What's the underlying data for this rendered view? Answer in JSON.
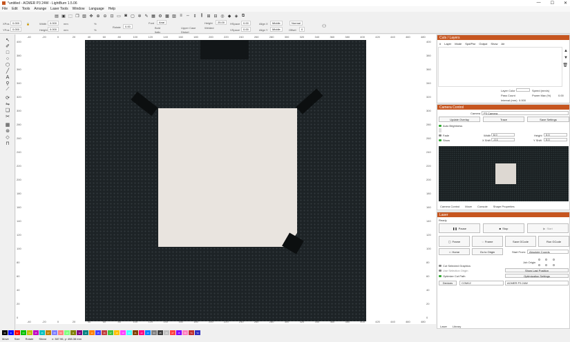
{
  "window": {
    "title": "*untitled - ACMER P3 24W - LightBurn 1.5.06",
    "min": "—",
    "max": "☐",
    "close": "✕"
  },
  "menu": [
    "File",
    "Edit",
    "Tools",
    "Arrange",
    "Laser Tools",
    "Window",
    "Language",
    "Help"
  ],
  "toolbar2": {
    "xpos_label": "XPos",
    "xpos": "0.000",
    "ypos_label": "YPos",
    "ypos": "0.000",
    "width_label": "Width",
    "width": "0.000",
    "height_label": "Height",
    "height": "0.000",
    "unit1": "mm",
    "unit2": "mm",
    "pct1": "%",
    "pct2": "%",
    "rotate_label": "Rotate",
    "rotate": "0.00",
    "font_label": "Font",
    "font": "Arial",
    "bold": "Bold",
    "italic": "Italic",
    "upper_case": "Upper Case",
    "welded": "Welded",
    "distort": "Distort",
    "height_text_label": "Height",
    "height_text": "25.00",
    "hspace_label": "HSpace",
    "hspace": "0.00",
    "vspace_label": "VSpace",
    "vspace": "0.00",
    "align_x_label": "Align X",
    "align_x": "Middle",
    "align_y_label": "Align Y",
    "align_y": "Middle",
    "normal": "Normal",
    "offset_label": "Offset",
    "offset": "0"
  },
  "rulers": {
    "top": [
      "-40",
      "-20",
      "0",
      "20",
      "40",
      "60",
      "80",
      "100",
      "120",
      "140",
      "160",
      "180",
      "200",
      "220",
      "240",
      "260",
      "280",
      "300",
      "320",
      "340",
      "360",
      "380",
      "400",
      "420",
      "440",
      "460",
      "480"
    ],
    "left": [
      "400",
      "380",
      "360",
      "340",
      "320",
      "300",
      "280",
      "260",
      "240",
      "220",
      "200",
      "180",
      "160",
      "140",
      "120",
      "100",
      "80",
      "60",
      "40",
      "20",
      "0"
    ]
  },
  "cuts_layers": {
    "title": "Cuts / Layers",
    "columns": [
      "#",
      "Layer",
      "Mode",
      "Spd/Pwr",
      "Output",
      "Show",
      "Air"
    ],
    "layer_color": "Layer Color",
    "speed_label": "Speed (mm/s)",
    "pass_count": "Pass Count",
    "power_label": "Power Max (%)",
    "interval_label": "Interval (mm)",
    "interval": "0.000",
    "power_value": "0.00"
  },
  "camera": {
    "title": "Camera Control",
    "camera_label": "Camera",
    "camera_value": "P3 Camera",
    "update_overlay": "Update Overlay",
    "trace": "Trace",
    "save_settings": "Save Settings",
    "auto_brightness": "Auto Brightness",
    "fade": "Fade",
    "show": "Show",
    "width_label": "Width",
    "width": "6.0",
    "height_label": "Height",
    "height": "0.0",
    "xshift_label": "X Shift",
    "xshift": "-0.1",
    "yshift_label": "Y Shift",
    "yshift": "0.0",
    "tabs": [
      "Camera Control",
      "Move",
      "Console",
      "Shape Properties"
    ]
  },
  "laser": {
    "title": "Laser",
    "status": "Ready",
    "pause": "Pause",
    "stop": "Stop",
    "start": "Start",
    "frame": "Frame",
    "frame2": "Frame",
    "save_gcode": "Save GCode",
    "run_gcode": "Run GCode",
    "home": "Home",
    "go_to_origin": "Go to Origin",
    "start_from_label": "Start From:",
    "start_from": "Absolute Coords",
    "job_origin": "Job Origin",
    "cut_selected": "Cut Selected Graphics",
    "use_selection_origin": "Use Selection Origin",
    "show_last_position": "Show Last Position",
    "optimize_cut_path": "Optimize Cut Path",
    "optimization_settings": "Optimization Settings",
    "devices_label": "Devices",
    "port": "COM12",
    "device": "ACMER P3 24W",
    "tabs": [
      "Laser",
      "Library"
    ]
  },
  "palette": [
    {
      "label": "00",
      "color": "#000000"
    },
    {
      "label": "01",
      "color": "#0000ff"
    },
    {
      "label": "02",
      "color": "#ff0000"
    },
    {
      "label": "03",
      "color": "#00c000"
    },
    {
      "label": "04",
      "color": "#c0c000"
    },
    {
      "label": "05",
      "color": "#c000c0"
    },
    {
      "label": "06",
      "color": "#00c0c0"
    },
    {
      "label": "07",
      "color": "#c08000"
    },
    {
      "label": "08",
      "color": "#8080ff"
    },
    {
      "label": "09",
      "color": "#ff8080"
    },
    {
      "label": "10",
      "color": "#80ff80"
    },
    {
      "label": "11",
      "color": "#808000"
    },
    {
      "label": "12",
      "color": "#800080"
    },
    {
      "label": "13",
      "color": "#008080"
    },
    {
      "label": "14",
      "color": "#ff8000"
    },
    {
      "label": "15",
      "color": "#4040ff"
    },
    {
      "label": "16",
      "color": "#c04040"
    },
    {
      "label": "17",
      "color": "#40c040"
    },
    {
      "label": "18",
      "color": "#ffc000"
    },
    {
      "label": "19",
      "color": "#ff40ff"
    },
    {
      "label": "20",
      "color": "#40ffff"
    },
    {
      "label": "21",
      "color": "#804000"
    },
    {
      "label": "22",
      "color": "#ff0080"
    },
    {
      "label": "23",
      "color": "#0080ff"
    },
    {
      "label": "24",
      "color": "#808080"
    },
    {
      "label": "25",
      "color": "#404040"
    },
    {
      "label": "26",
      "color": "#c0c0c0"
    },
    {
      "label": "27",
      "color": "#ff4040"
    },
    {
      "label": "28",
      "color": "#8000ff"
    },
    {
      "label": "29",
      "color": "#ff80c0"
    },
    {
      "label": "T1",
      "color": "#c03030"
    },
    {
      "label": "T2",
      "color": "#3030c0"
    }
  ],
  "status": {
    "move": "Move",
    "size": "Size",
    "rotate": "Rotate",
    "shear": "Shear",
    "coords": "x: 387.96, y: 498.38 mm"
  }
}
